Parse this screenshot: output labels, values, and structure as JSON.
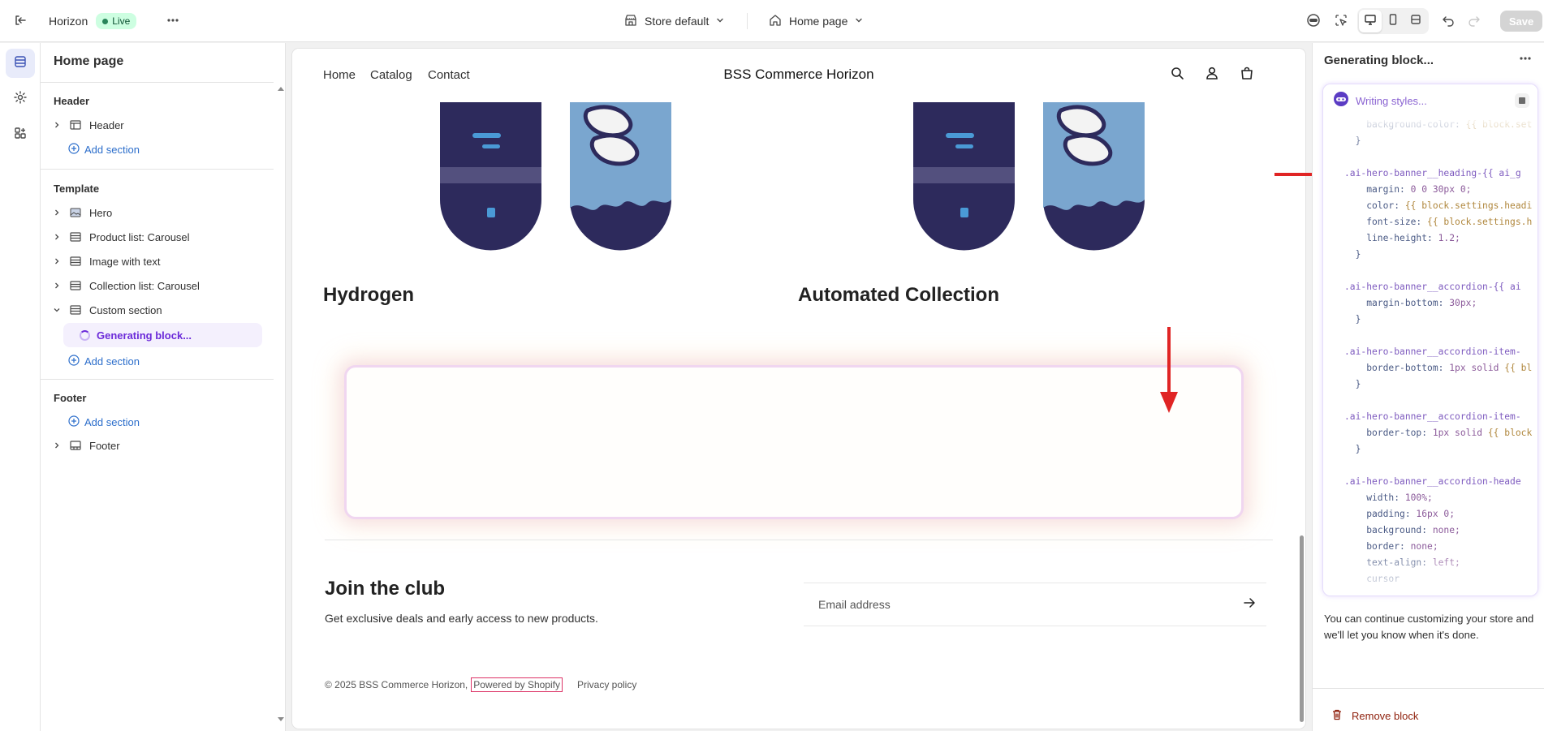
{
  "topbar": {
    "app_name": "Horizon",
    "live_label": "Live",
    "store_selector": "Store default",
    "page_selector": "Home page",
    "save_label": "Save"
  },
  "sidebar": {
    "title": "Home page",
    "groups": {
      "header": {
        "title": "Header",
        "items": [
          "Header"
        ],
        "add": "Add section"
      },
      "template": {
        "title": "Template",
        "items": [
          "Hero",
          "Product list: Carousel",
          "Image with text",
          "Collection list: Carousel",
          "Custom section"
        ],
        "generating": "Generating block...",
        "add": "Add section"
      },
      "footer": {
        "title": "Footer",
        "add": "Add section",
        "items": [
          "Footer"
        ]
      }
    }
  },
  "preview": {
    "nav": {
      "links": [
        "Home",
        "Catalog",
        "Contact"
      ],
      "store_name": "BSS Commerce Horizon"
    },
    "collections": [
      "Hydrogen",
      "Automated Collection"
    ],
    "newsletter": {
      "title": "Join the club",
      "subtitle": "Get exclusive deals and early access to new products.",
      "email_placeholder": "Email address"
    },
    "footer": {
      "copyright": "© 2025 BSS Commerce Horizon,",
      "powered": "Powered by Shopify",
      "privacy": "Privacy policy"
    }
  },
  "ai_panel": {
    "title": "Generating block...",
    "status": "Writing styles...",
    "code_lines": [
      "    background-color: {{ block.set",
      "  }",
      "",
      ".ai-hero-banner__heading-{{ ai_g",
      "    margin: 0 0 30px 0;",
      "    color: {{ block.settings.headi",
      "    font-size: {{ block.settings.h",
      "    line-height: 1.2;",
      "  }",
      "",
      ".ai-hero-banner__accordion-{{ ai",
      "    margin-bottom: 30px;",
      "  }",
      "",
      ".ai-hero-banner__accordion-item-",
      "    border-bottom: 1px solid {{ bl",
      "  }",
      "",
      ".ai-hero-banner__accordion-item-",
      "    border-top: 1px solid {{ block",
      "  }",
      "",
      ".ai-hero-banner__accordion-heade",
      "    width: 100%;",
      "    padding: 16px 0;",
      "    background: none;",
      "    border: none;",
      "    text-align: left;",
      "    cursor"
    ],
    "note": "You can continue customizing your store and we'll let you know when it's done.",
    "remove_label": "Remove block"
  },
  "colors": {
    "accent_purple": "#6c2bd9",
    "link_blue": "#2c6ecb",
    "annotation_red": "#e02424",
    "live_green": "#29845a"
  }
}
